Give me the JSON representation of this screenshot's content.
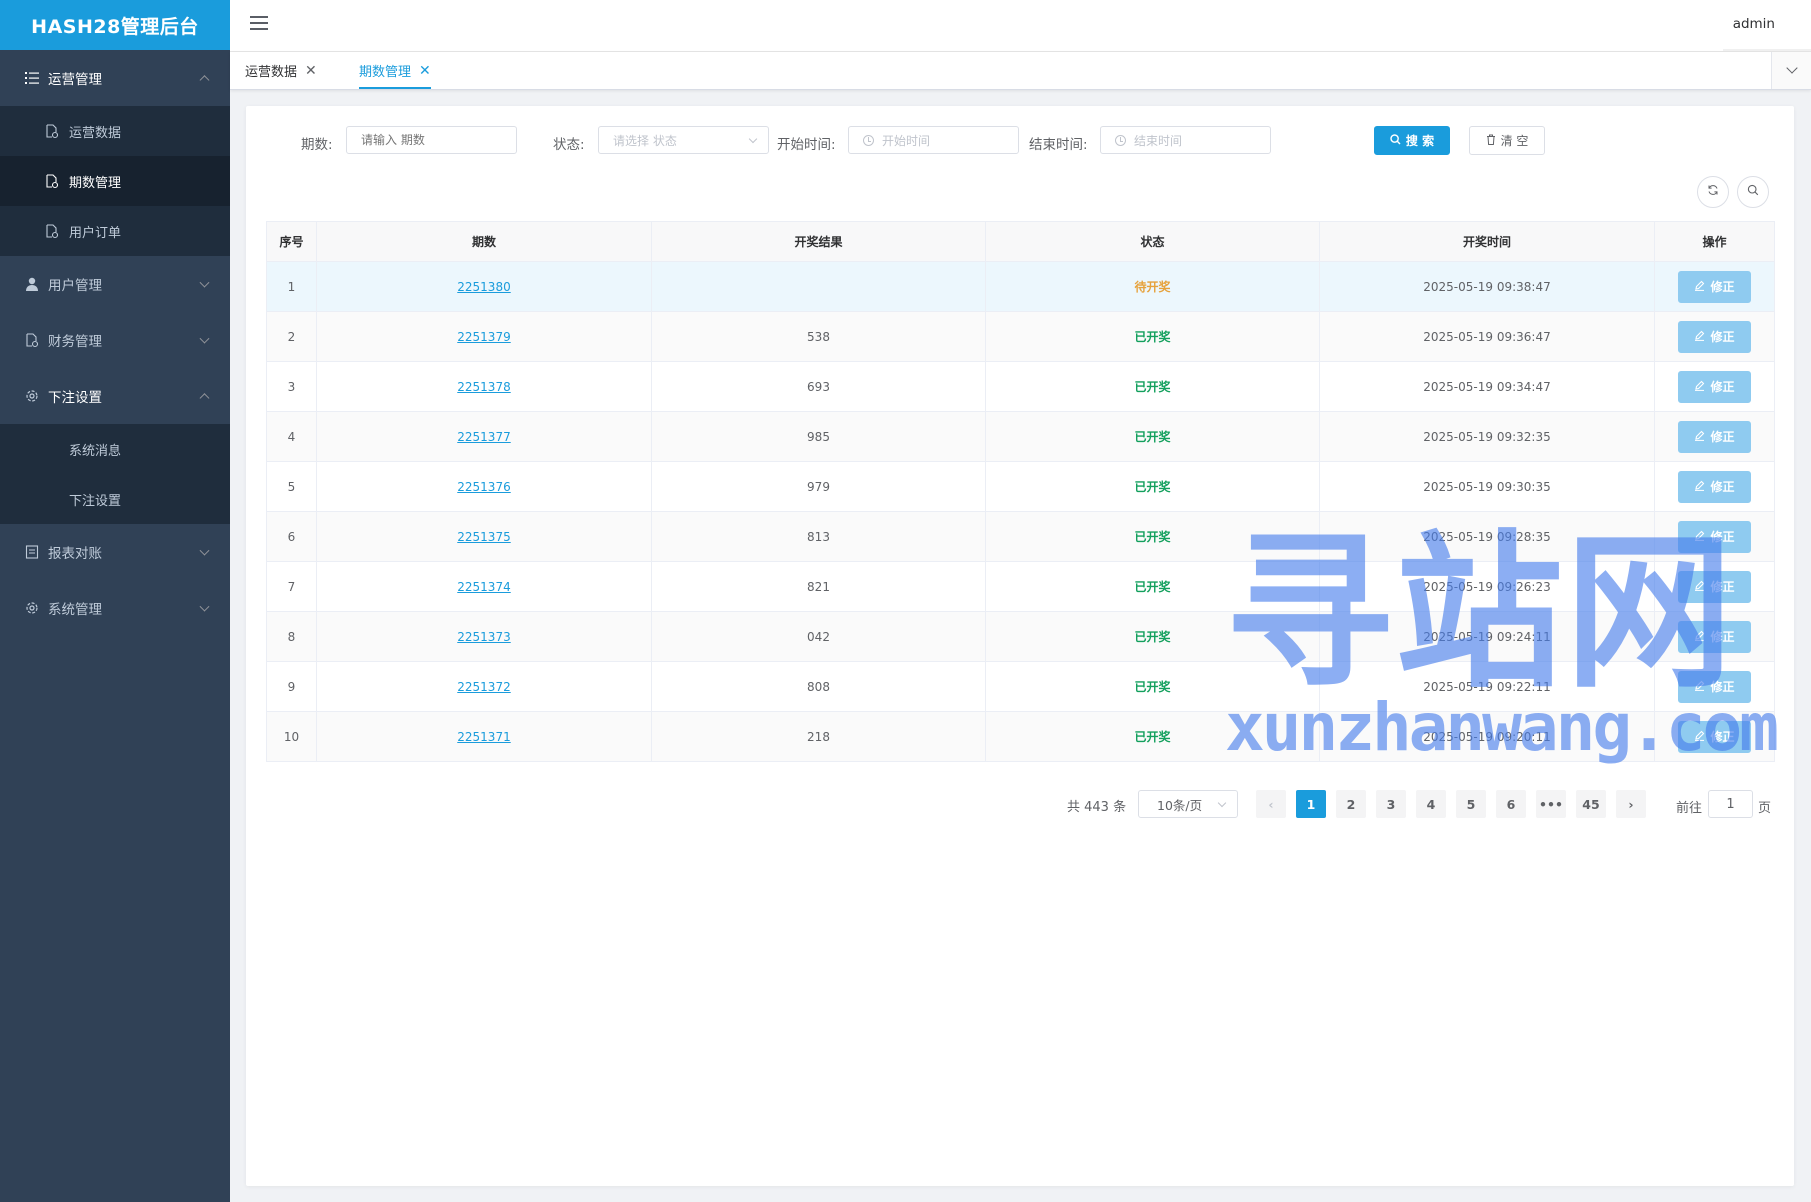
{
  "app": {
    "title": "HASH28管理后台"
  },
  "sidebar": {
    "groups": [
      {
        "label": "运营管理",
        "icon": "list-icon",
        "open": true,
        "items": [
          {
            "label": "运营数据",
            "icon": "document-icon",
            "active": false
          },
          {
            "label": "期数管理",
            "icon": "document-icon",
            "active": true
          },
          {
            "label": "用户订单",
            "icon": "document-icon",
            "active": false
          }
        ]
      },
      {
        "label": "用户管理",
        "icon": "user-icon",
        "open": false,
        "items": []
      },
      {
        "label": "财务管理",
        "icon": "document-icon",
        "open": false,
        "items": []
      },
      {
        "label": "下注设置",
        "icon": "gear-icon",
        "open": true,
        "items": [
          {
            "label": "系统消息"
          },
          {
            "label": "下注设置"
          }
        ]
      },
      {
        "label": "报表对账",
        "icon": "report-icon",
        "open": false,
        "items": []
      },
      {
        "label": "系统管理",
        "icon": "gear-icon",
        "open": false,
        "items": []
      }
    ]
  },
  "header": {
    "user": "admin"
  },
  "tabs": [
    {
      "label": "运营数据",
      "active": false
    },
    {
      "label": "期数管理",
      "active": true
    }
  ],
  "filters": {
    "period_label": "期数:",
    "period_placeholder": "请输入 期数",
    "status_label": "状态:",
    "status_placeholder": "请选择 状态",
    "start_label": "开始时间:",
    "start_placeholder": "开始时间",
    "end_label": "结束时间:",
    "end_placeholder": "结束时间",
    "search_label": "搜 索",
    "clear_label": "清 空"
  },
  "table": {
    "columns": [
      "序号",
      "期数",
      "开奖结果",
      "状态",
      "开奖时间",
      "操作"
    ],
    "edit_label": "修正",
    "rows": [
      {
        "index": "1",
        "period": "2251380",
        "result": "",
        "status": "待开奖",
        "status_type": "pending",
        "time": "2025-05-19 09:38:47"
      },
      {
        "index": "2",
        "period": "2251379",
        "result": "538",
        "status": "已开奖",
        "status_type": "done",
        "time": "2025-05-19 09:36:47"
      },
      {
        "index": "3",
        "period": "2251378",
        "result": "693",
        "status": "已开奖",
        "status_type": "done",
        "time": "2025-05-19 09:34:47"
      },
      {
        "index": "4",
        "period": "2251377",
        "result": "985",
        "status": "已开奖",
        "status_type": "done",
        "time": "2025-05-19 09:32:35"
      },
      {
        "index": "5",
        "period": "2251376",
        "result": "979",
        "status": "已开奖",
        "status_type": "done",
        "time": "2025-05-19 09:30:35"
      },
      {
        "index": "6",
        "period": "2251375",
        "result": "813",
        "status": "已开奖",
        "status_type": "done",
        "time": "2025-05-19 09:28:35"
      },
      {
        "index": "7",
        "period": "2251374",
        "result": "821",
        "status": "已开奖",
        "status_type": "done",
        "time": "2025-05-19 09:26:23"
      },
      {
        "index": "8",
        "period": "2251373",
        "result": "042",
        "status": "已开奖",
        "status_type": "done",
        "time": "2025-05-19 09:24:11"
      },
      {
        "index": "9",
        "period": "2251372",
        "result": "808",
        "status": "已开奖",
        "status_type": "done",
        "time": "2025-05-19 09:22:11"
      },
      {
        "index": "10",
        "period": "2251371",
        "result": "218",
        "status": "已开奖",
        "status_type": "done",
        "time": "2025-05-19 09:20:11"
      }
    ]
  },
  "pagination": {
    "total_text": "共 443 条",
    "page_size": "10条/页",
    "pages": [
      "1",
      "2",
      "3",
      "4",
      "5",
      "6",
      "•••",
      "45"
    ],
    "current": "1",
    "goto_prefix": "前往",
    "goto_value": "1",
    "goto_suffix": "页"
  },
  "watermark": {
    "cn": "寻站网",
    "en": "xunzhanwang.com"
  },
  "colors": {
    "brand": "#1a9cdc",
    "sidebar": "#304156",
    "pending": "#e6a23c",
    "done": "#13a05d"
  }
}
